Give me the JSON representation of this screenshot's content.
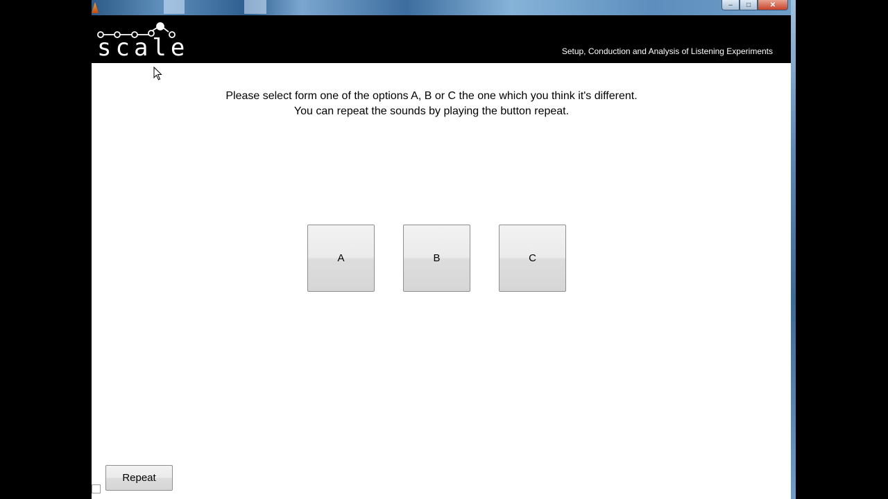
{
  "header": {
    "logo_text": "scale",
    "tagline": "Setup, Conduction and Analysis of Listening Experiments"
  },
  "titlebar": {
    "minimize_icon": "minimize-icon",
    "maximize_icon": "maximize-icon",
    "close_icon": "close-icon",
    "close_glyph": "✕",
    "min_glyph": "–",
    "max_glyph": "□"
  },
  "main": {
    "instruction_line1": "Please select form one of the options A, B or C the one which you think it's different.",
    "instruction_line2": "You can repeat the sounds by playing the button repeat.",
    "options": [
      {
        "label": "A"
      },
      {
        "label": "B"
      },
      {
        "label": "C"
      }
    ],
    "repeat_label": "Repeat"
  },
  "colors": {
    "header_bg": "#000000",
    "content_bg": "#ffffff",
    "titlebar_accent": "#5f8fbb"
  }
}
